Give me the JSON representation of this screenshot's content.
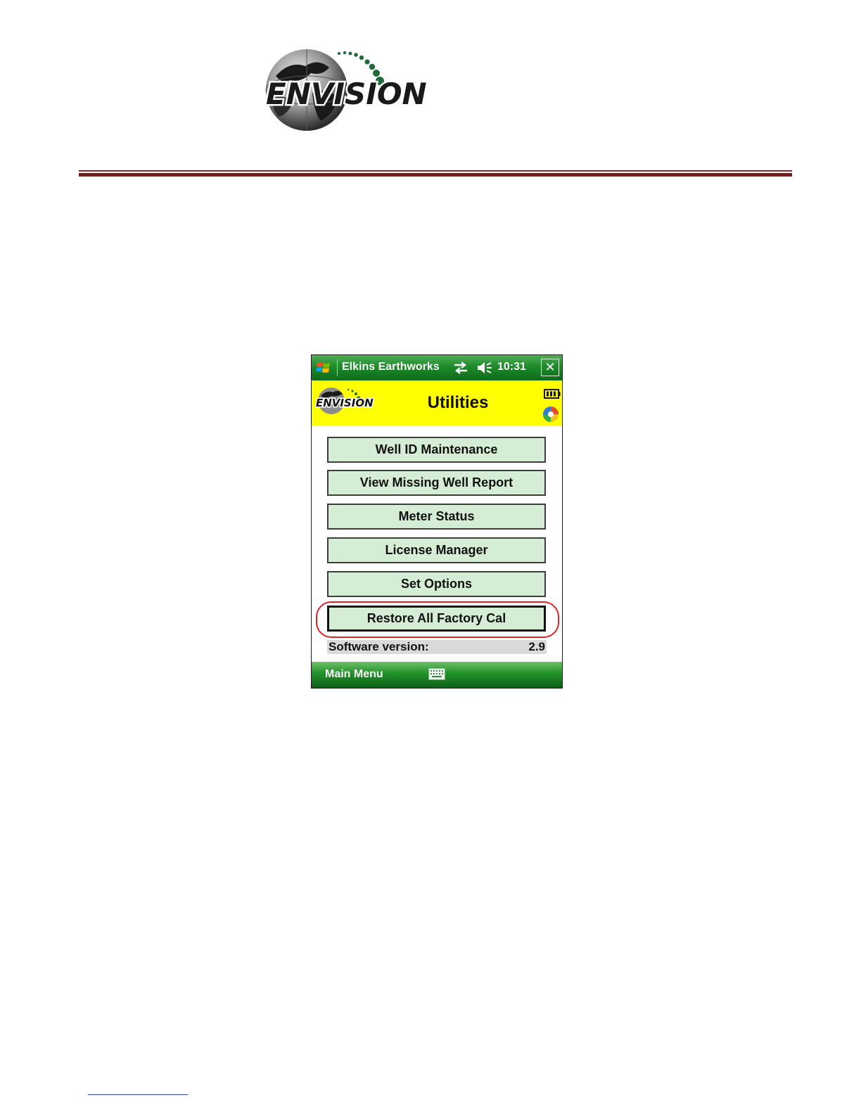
{
  "document": {
    "logo_text": "ENVISION"
  },
  "device": {
    "titlebar": {
      "title": "Elkins Earthworks",
      "time": "10:31",
      "close_symbol": "✕"
    },
    "app_header": {
      "logo_text": "ENVISION",
      "title": "Utilities"
    },
    "menu": [
      {
        "label": "Well ID Maintenance"
      },
      {
        "label": "View Missing Well Report"
      },
      {
        "label": "Meter Status"
      },
      {
        "label": "License Manager"
      },
      {
        "label": "Set Options"
      },
      {
        "label": "Restore All Factory Cal"
      }
    ],
    "version": {
      "label": "Software version:",
      "value": "2.9"
    },
    "softkeys": {
      "left": "Main Menu"
    },
    "colors": {
      "header_bg": "#ffff00",
      "button_bg": "#d4edd4",
      "highlight": "#e0242a",
      "titlebar_green": "#1e8a2a"
    }
  }
}
